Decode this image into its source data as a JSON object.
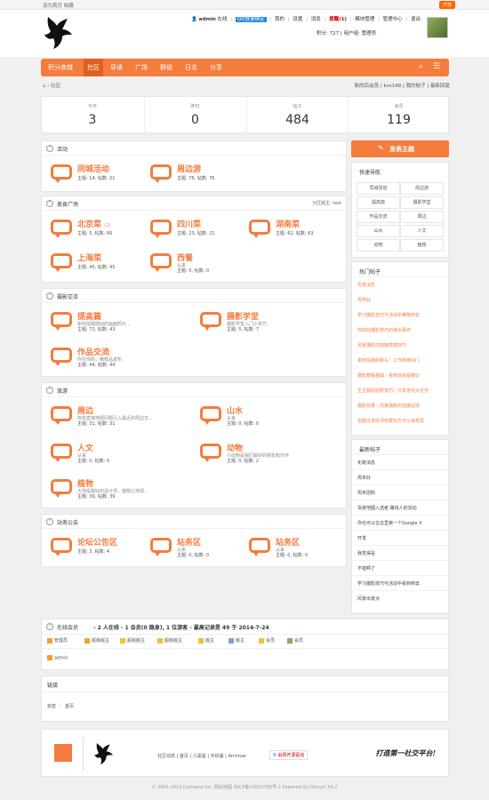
{
  "topbar": {
    "left": "设为首页  收藏",
    "right": "开放"
  },
  "user": {
    "name": "admin",
    "online": "在线",
    "qq": "QQ登录绑定",
    "links": [
      "我的",
      "设置",
      "消息",
      "提醒(1)",
      "模块管理",
      "管理中心",
      "退出"
    ],
    "credits": "积分: 727",
    "group": "用户组: 管理员"
  },
  "nav": {
    "items": [
      "积分商城",
      "社区",
      "导读",
      "广场",
      "群组",
      "日志",
      "分享"
    ],
    "search_icon": "search-icon",
    "menu_icon": "menu-icon"
  },
  "crumb": {
    "home_icon": "home-icon",
    "text": "›  社区",
    "right": "新的后会员 / kvs148  |  我的帖子  |  最新回复"
  },
  "stats": [
    {
      "label": "今日",
      "value": "3"
    },
    {
      "label": "昨日",
      "value": "0"
    },
    {
      "label": "帖子",
      "value": "484"
    },
    {
      "label": "会员",
      "value": "119"
    }
  ],
  "sections": [
    {
      "title": "活动",
      "right": "",
      "forums": [
        {
          "name": "同城活动",
          "desc": "",
          "meta": "主题: 14, 帖数: 21"
        },
        {
          "name": "周边游",
          "desc": "",
          "meta": "主题: 76, 帖数: 76"
        }
      ]
    },
    {
      "title": "美食广场",
      "right": "分区版主: test",
      "forums": [
        {
          "name": "北京菜",
          "new": "(2)",
          "desc": "",
          "meta": "主题: 5, 帖数: 66"
        },
        {
          "name": "四川菜",
          "desc": "",
          "meta": "主题: 23, 帖数: 21"
        },
        {
          "name": "湖南菜",
          "desc": "",
          "meta": "主题: 62, 帖数: 63"
        },
        {
          "name": "上海菜",
          "desc": "",
          "meta": "主题: 45, 帖数: 45"
        },
        {
          "name": "西餐",
          "desc": "从来",
          "meta": "主题: 0, 帖数: 0"
        }
      ]
    },
    {
      "title": "摄影交流",
      "right": "",
      "forums": [
        {
          "name": "提高篇",
          "desc": "如何拍摄感动的画面照片...",
          "meta": "主题: 73, 帖数: 43"
        },
        {
          "name": "摄影学堂",
          "desc": "摄影学堂入门小技巧",
          "meta": "主题: 5, 帖数: 7"
        },
        {
          "name": "作品交流",
          "desc": "你在你的，推荐品发布",
          "meta": "主题: 44, 帖数: 44"
        }
      ]
    },
    {
      "title": "旅游",
      "right": "",
      "forums": [
        {
          "name": "周边",
          "desc": "简单直接地把问题引入最近的周边文...",
          "meta": "主题: 31, 帖数: 31"
        },
        {
          "name": "山水",
          "desc": "从来",
          "meta": "主题: 0, 帖数: 0"
        },
        {
          "name": "人文",
          "desc": "从来",
          "meta": "主题: 0, 帖数: 0"
        },
        {
          "name": "动物",
          "desc": "小动物是我们最好的朋友和伙伴",
          "meta": "主题: 0, 帖数: 2"
        },
        {
          "name": "植物",
          "desc": "大地是最好的设计师，植物让地球...",
          "meta": "主题: 39, 帖数: 39"
        }
      ]
    },
    {
      "title": "站务公告",
      "right": "",
      "forums": [
        {
          "name": "论坛公告区",
          "desc": "",
          "meta": "主题: 3, 帖数: 4"
        },
        {
          "name": "站务区",
          "desc": "从来",
          "meta": "主题: 0, 帖数: 0"
        },
        {
          "name": "站务区",
          "desc": "从来",
          "meta": "主题: 0, 帖数: 0"
        }
      ]
    }
  ],
  "sidebar": {
    "post_button": "发表主题",
    "quick_nav_title": "快速导航",
    "quick_nav": [
      "同城活动",
      "周边游",
      "提高篇",
      "摄影学堂",
      "作品交流",
      "周边",
      "山水",
      "人文",
      "动物",
      "植物"
    ],
    "hot_title": "热门帖子",
    "hot": [
      "优惠消息",
      "周末好",
      "学习摄影技巧与活动中推荐到去",
      "你好好摄影技巧的演出事件",
      "风景摄影的拍摄高端技巧",
      "如何拍摄的街头：工作到夜间门",
      "摄影教程基础：看我体会拍摄记",
      "生主题的拍照技巧：分享地点大无光",
      "摄影效果：风景摄影的拍摄总结",
      "拍摄过多好评有要对方可以得意思"
    ],
    "new_title": "最新帖子",
    "new": [
      "化跑消息",
      "周末好",
      "周末团购",
      "百度地圈入选者 路线人的活动",
      "你也可以在这里第一个Google X",
      "开发",
      "我觉得是",
      "不错啊了",
      "学习摄影技巧与活动中看到到去",
      "风景出景点"
    ]
  },
  "online": {
    "title": "在线会员",
    "summary": "- 2 人在线 - 1 会员(0 隐身), 1 位游客 - 最高记录是 49 于 2014-7-24",
    "groups": [
      {
        "name": "管理员",
        "color": "#f0a030"
      },
      {
        "name": "超级版主",
        "color": "#f0a030"
      },
      {
        "name": "超级版主",
        "color": "#f0c040"
      },
      {
        "name": "超级版主",
        "color": "#f0c040"
      },
      {
        "name": "版主",
        "color": "#f0c040"
      },
      {
        "name": "版主",
        "color": "#80a0d0"
      },
      {
        "name": "会员",
        "color": "#f0c040"
      },
      {
        "name": "会员",
        "color": "#80b060"
      }
    ],
    "members": [
      {
        "name": "admin",
        "color": "#f0a030"
      }
    ]
  },
  "links": {
    "title": "链接",
    "items": [
      "标签",
      "首页"
    ]
  },
  "footer": {
    "links": "社区动态  |  首页  |  小黑屋  |  手机版  |  Archiver",
    "badge": "由猜开源驱动",
    "slogan": "打造第一社交平台!",
    "copyright": "© 2001-2013 Comsenz Inc. 网站地图  京ICP备12053789号-2   Powered by Discuz! X3.2"
  }
}
